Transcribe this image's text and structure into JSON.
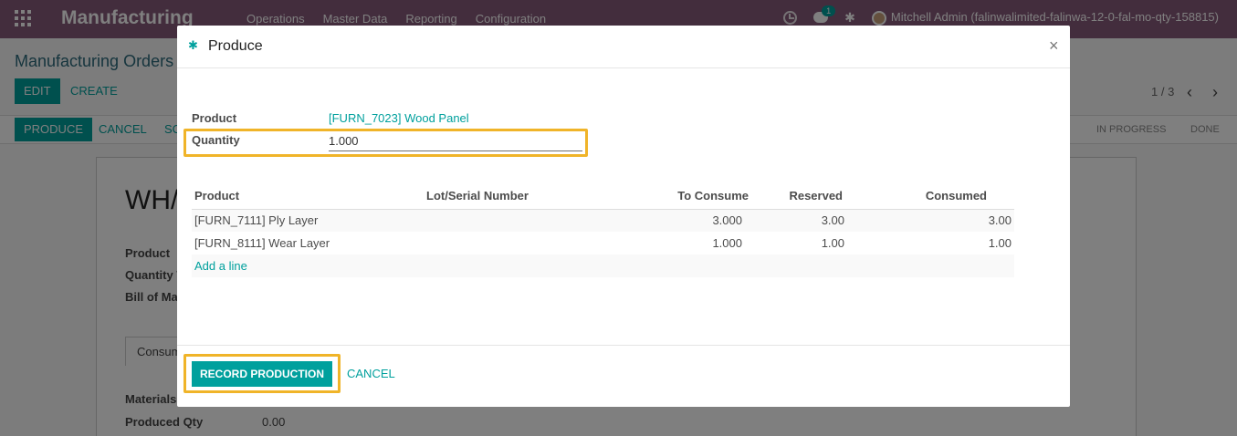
{
  "navbar": {
    "brand": "Manufacturing",
    "menu": [
      "Operations",
      "Master Data",
      "Reporting",
      "Configuration"
    ],
    "message_count": "1",
    "user": "Mitchell Admin (falinwalimited-falinwa-12-0-fal-mo-qty-158815)"
  },
  "background": {
    "breadcrumb": "Manufacturing Orders",
    "edit_label": "EDIT",
    "create_label": "CREATE",
    "pager": "1 / 3",
    "produce_label": "PRODUCE",
    "cancel_label": "CANCEL",
    "partial_button": "SC",
    "stages": [
      "IN PROGRESS",
      "DONE"
    ],
    "record_title": "WH/",
    "labels": [
      "Product",
      "Quantity T",
      "Bill of Ma"
    ],
    "tab_label": "Consum",
    "materials_label": "Materials",
    "produced_qty_label": "Produced Qty",
    "produced_qty_value": "0.00"
  },
  "modal": {
    "title": "Produce",
    "close_glyph": "×",
    "product_label": "Product",
    "product_value": "[FURN_7023] Wood Panel",
    "quantity_label": "Quantity",
    "quantity_value": "1.000",
    "table": {
      "headers": [
        "Product",
        "Lot/Serial Number",
        "To Consume",
        "Reserved",
        "Consumed"
      ],
      "rows": [
        {
          "product": "[FURN_7111] Ply Layer",
          "lot": "",
          "to_consume": "3.000",
          "reserved": "3.00",
          "consumed": "3.00"
        },
        {
          "product": "[FURN_8111] Wear Layer",
          "lot": "",
          "to_consume": "1.000",
          "reserved": "1.00",
          "consumed": "1.00"
        }
      ],
      "add_line": "Add a line"
    },
    "record_label": "RECORD PRODUCTION",
    "cancel_label": "CANCEL"
  },
  "colors": {
    "navbar": "#875a7b",
    "accent": "#00a09d",
    "highlight": "#f0b429"
  }
}
